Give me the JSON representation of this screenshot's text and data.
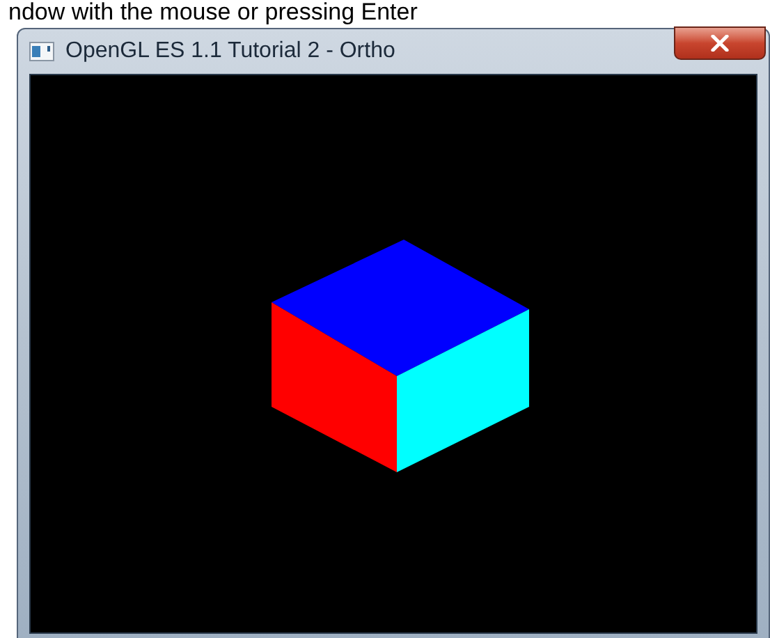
{
  "caption": "ndow with the mouse or pressing Enter",
  "window": {
    "title": "OpenGL ES 1.1 Tutorial 2 - Ortho"
  }
}
